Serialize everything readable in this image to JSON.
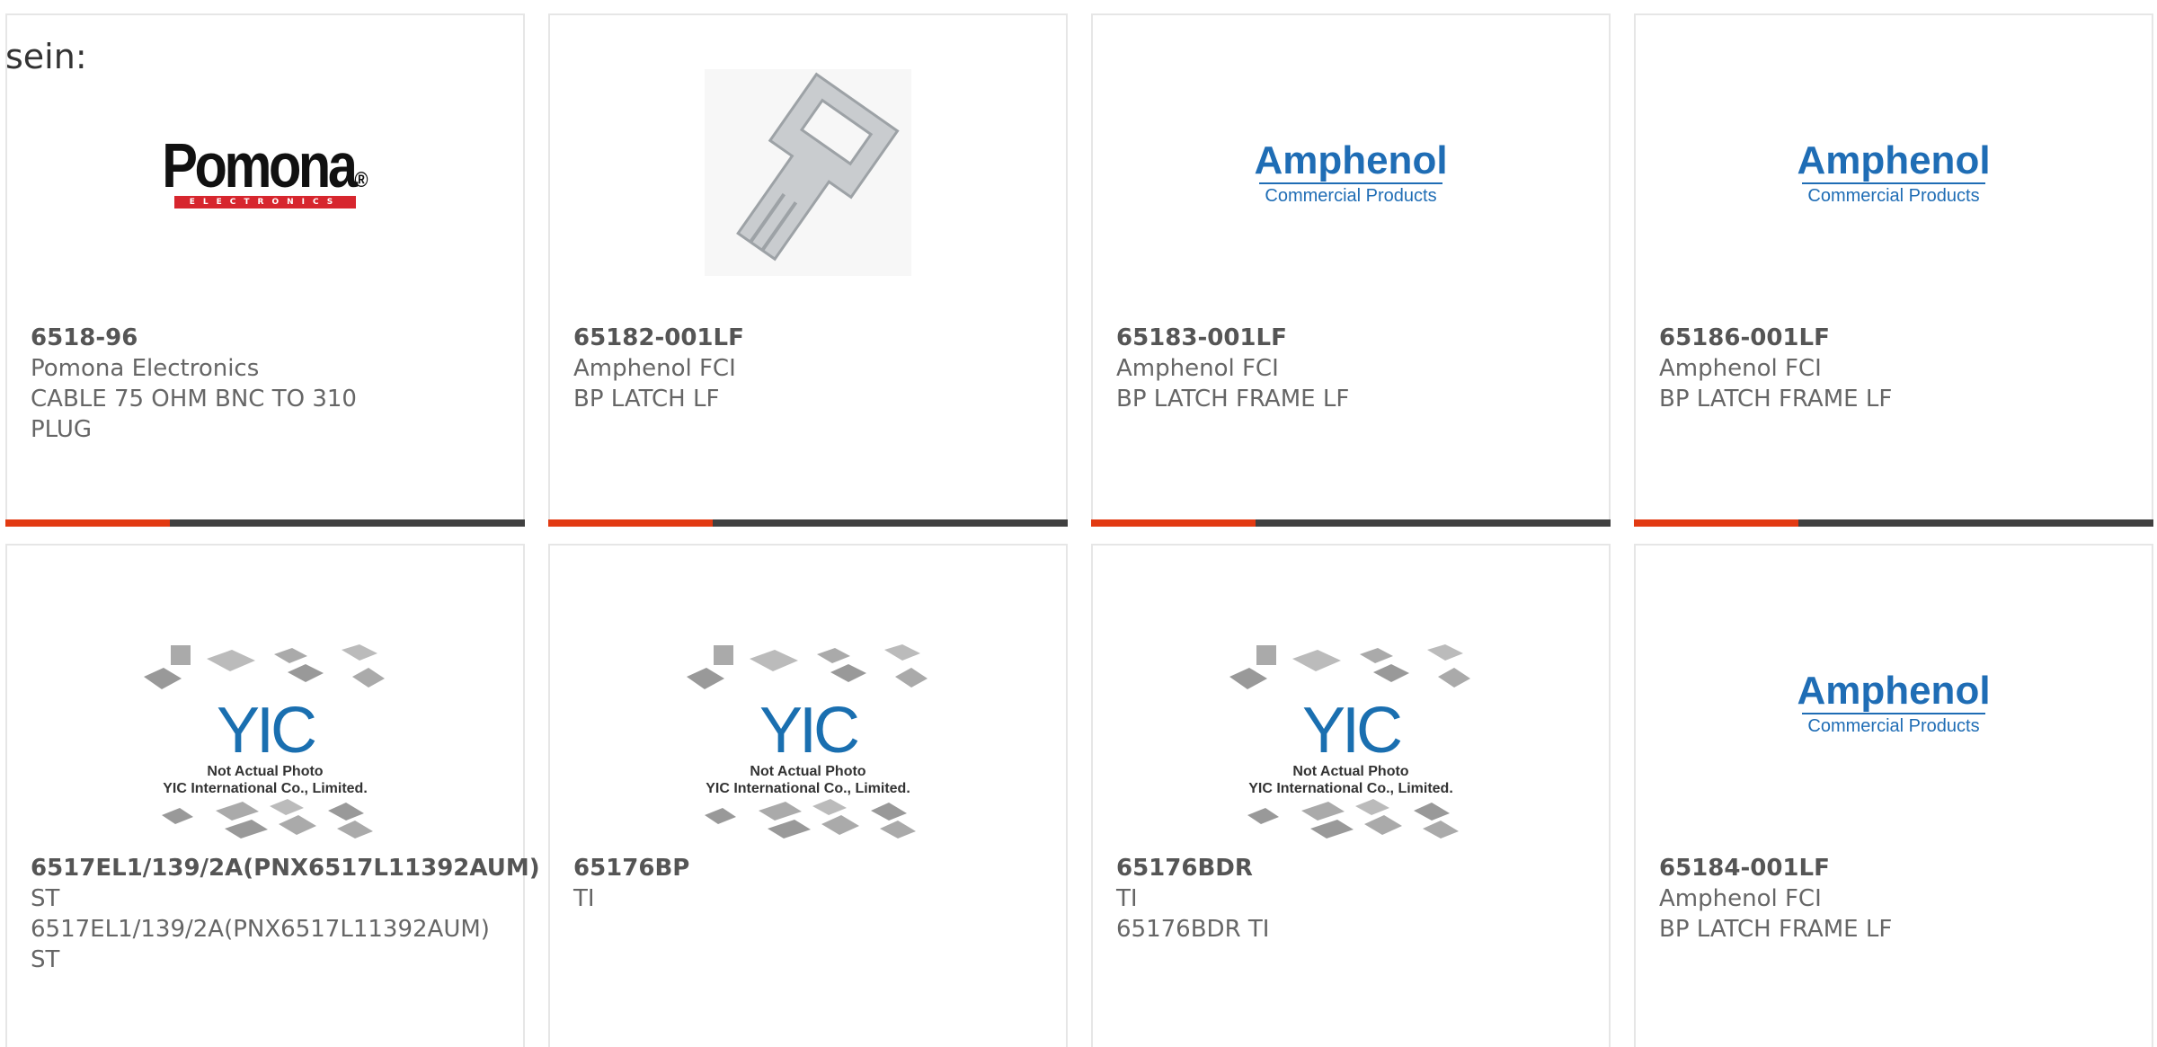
{
  "header": {
    "text": "sein:"
  },
  "colors": {
    "accent": "#e23a12",
    "bar": "#404040",
    "amphenol_blue": "#1f6db5",
    "pomona_red": "#d7262e"
  },
  "logos": {
    "pomona": {
      "word": "Pomona",
      "strip": "ELECTRONICS"
    },
    "amphenol": {
      "name": "Amphenol",
      "sub": "Commercial Products"
    },
    "yic": {
      "logo": "YIC",
      "line1": "Not Actual Photo",
      "line2": "YIC International Co., Limited."
    }
  },
  "products": [
    {
      "part": "6518-96",
      "maker": "Pomona Electronics",
      "desc": "CABLE 75 OHM BNC TO 310 PLUG",
      "image": "pomona-logo"
    },
    {
      "part": "65182-001LF",
      "maker": "Amphenol FCI",
      "desc": "BP LATCH LF",
      "image": "latch-photo"
    },
    {
      "part": "65183-001LF",
      "maker": "Amphenol FCI",
      "desc": "BP LATCH FRAME LF",
      "image": "amphenol-logo"
    },
    {
      "part": "65186-001LF",
      "maker": "Amphenol FCI",
      "desc": "BP LATCH FRAME LF",
      "image": "amphenol-logo"
    },
    {
      "part": "6517EL1/139/2A(PNX6517L11392AUM)",
      "maker": "ST",
      "desc": "6517EL1/139/2A(PNX6517L11392AUM) ST",
      "image": "yic-placeholder"
    },
    {
      "part": "65176BP",
      "maker": "TI",
      "desc": "",
      "image": "yic-placeholder"
    },
    {
      "part": "65176BDR",
      "maker": "TI",
      "desc": "65176BDR TI",
      "image": "yic-placeholder"
    },
    {
      "part": "65184-001LF",
      "maker": "Amphenol FCI",
      "desc": "BP LATCH FRAME LF",
      "image": "amphenol-logo"
    }
  ]
}
